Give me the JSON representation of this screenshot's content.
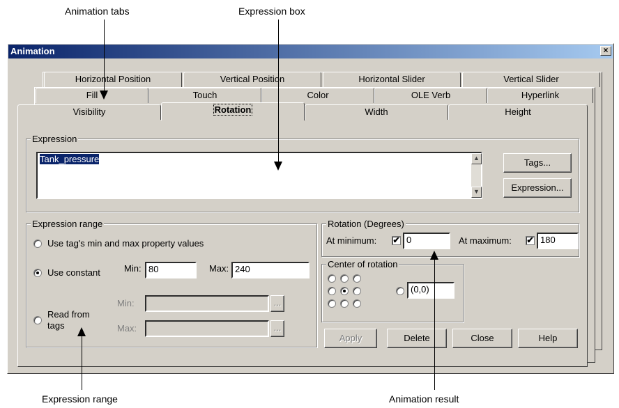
{
  "callouts": {
    "animation_tabs": "Animation tabs",
    "expression_box": "Expression box",
    "expression_range": "Expression range",
    "animation_result": "Animation result"
  },
  "window": {
    "title": "Animation",
    "close_label": "×"
  },
  "tabs": {
    "row1": [
      "Horizontal Position",
      "Vertical Position",
      "Horizontal Slider",
      "Vertical Slider"
    ],
    "row2": [
      "Fill",
      "Touch",
      "Color",
      "OLE Verb",
      "Hyperlink"
    ],
    "row3": [
      "Visibility",
      "Rotation",
      "Width",
      "Height"
    ],
    "active": "Rotation"
  },
  "expression": {
    "group_label": "Expression",
    "value": "Tank_pressure",
    "tags_button": "Tags...",
    "expression_button": "Expression..."
  },
  "expression_range": {
    "group_label": "Expression range",
    "option_tag_props": "Use tag's min and max property values",
    "option_constant": "Use constant",
    "option_read_tags_line1": "Read from",
    "option_read_tags_line2": "tags",
    "selected_option": "Use constant",
    "min_label": "Min:",
    "min_value": "80",
    "max_label": "Max:",
    "max_value": "240",
    "tag_min_label": "Min:",
    "tag_max_label": "Max:",
    "browse_label": "..."
  },
  "rotation": {
    "group_label": "Rotation (Degrees)",
    "at_min_label": "At minimum:",
    "at_min_checked": true,
    "at_min_value": "0",
    "at_max_label": "At maximum:",
    "at_max_checked": true,
    "at_max_value": "180",
    "check_mark": "✔"
  },
  "center_of_rotation": {
    "group_label": "Center of rotation",
    "selected": "center",
    "custom_value": "(0,0)"
  },
  "buttons": {
    "apply": "Apply",
    "delete": "Delete",
    "close": "Close",
    "help": "Help"
  },
  "scroll": {
    "up_arrow": "▲",
    "down_arrow": "▼"
  }
}
